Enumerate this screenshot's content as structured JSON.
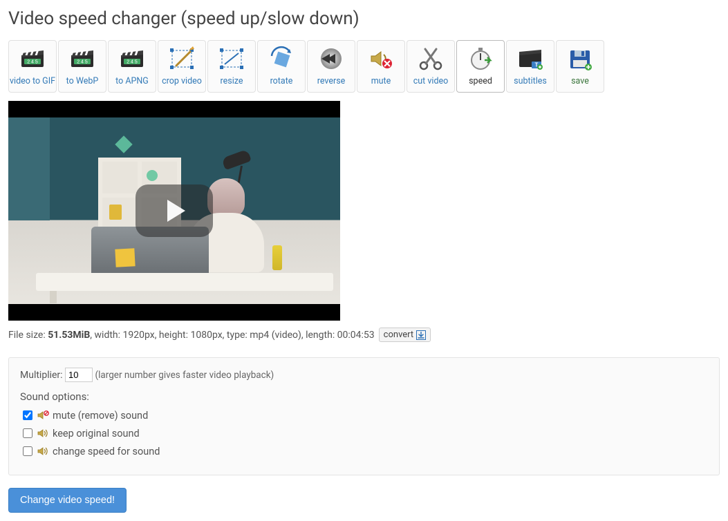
{
  "page_title": "Video speed changer (speed up/slow down)",
  "toolbar": [
    {
      "id": "video-to-gif",
      "label": "video to GIF",
      "icon": "clapper-gif"
    },
    {
      "id": "to-webp",
      "label": "to WebP",
      "icon": "clapper-webp"
    },
    {
      "id": "to-apng",
      "label": "to APNG",
      "icon": "clapper-apng"
    },
    {
      "id": "crop-video",
      "label": "crop video",
      "icon": "crop"
    },
    {
      "id": "resize",
      "label": "resize",
      "icon": "resize"
    },
    {
      "id": "rotate",
      "label": "rotate",
      "icon": "rotate"
    },
    {
      "id": "reverse",
      "label": "reverse",
      "icon": "reverse"
    },
    {
      "id": "mute",
      "label": "mute",
      "icon": "mute"
    },
    {
      "id": "cut-video",
      "label": "cut video",
      "icon": "scissors"
    },
    {
      "id": "speed",
      "label": "speed",
      "icon": "stopwatch",
      "active": true
    },
    {
      "id": "subtitles",
      "label": "subtitles",
      "icon": "subtitles"
    },
    {
      "id": "save",
      "label": "save",
      "icon": "floppy",
      "style": "save"
    }
  ],
  "file": {
    "size_label": "File size: ",
    "size_value": "51.53MiB",
    "width_label": ", width: 1920px",
    "height_label": ", height: 1080px",
    "type_label": ", type: mp4 (video)",
    "length_label": ", length: 00:04:53",
    "convert_label": "convert"
  },
  "options": {
    "multiplier_label": "Multiplier:",
    "multiplier_value": "10",
    "multiplier_hint": "(larger number gives faster video playback)",
    "sound_title": "Sound options:",
    "opts": [
      {
        "id": "mute-sound",
        "label": "mute (remove) sound",
        "checked": true,
        "icon": "speaker-mute"
      },
      {
        "id": "keep-sound",
        "label": "keep original sound",
        "checked": false,
        "icon": "speaker-on"
      },
      {
        "id": "change-sound",
        "label": "change speed for sound",
        "checked": false,
        "icon": "speaker-on"
      }
    ]
  },
  "submit_label": "Change video speed!"
}
